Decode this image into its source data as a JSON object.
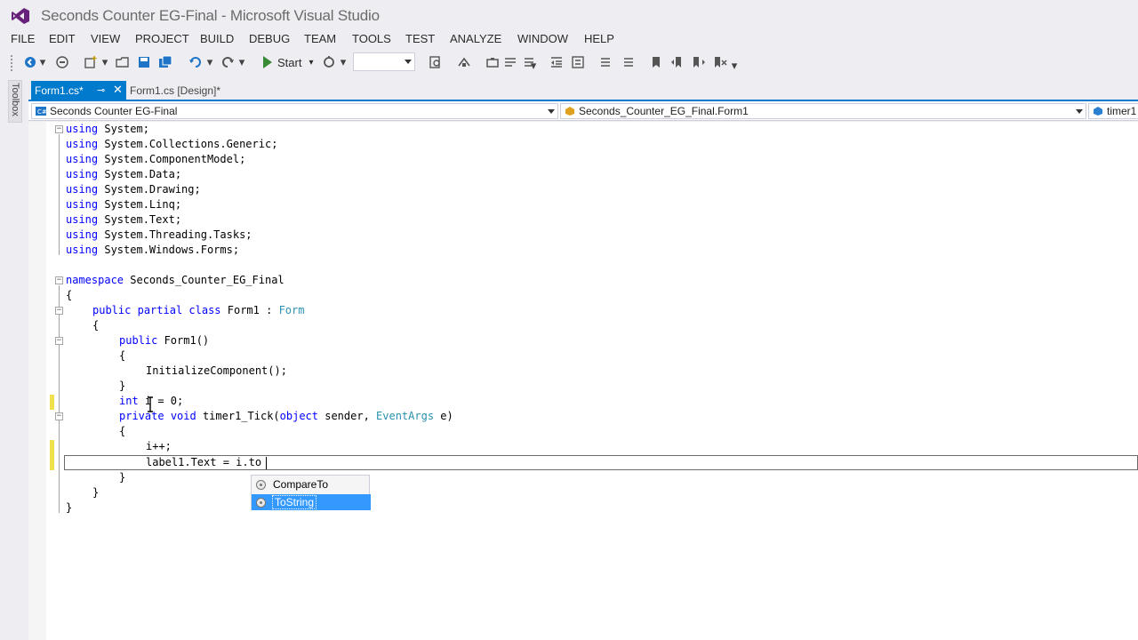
{
  "window": {
    "title": "Seconds Counter EG-Final - Microsoft Visual Studio"
  },
  "menu": [
    "FILE",
    "EDIT",
    "VIEW",
    "PROJECT",
    "BUILD",
    "DEBUG",
    "TEAM",
    "TOOLS",
    "TEST",
    "ANALYZE",
    "WINDOW",
    "HELP"
  ],
  "toolbar": {
    "start_label": "Start",
    "config_value": ""
  },
  "toolbox": {
    "label": "Toolbox"
  },
  "tabs": [
    {
      "label": "Form1.cs*",
      "active": true
    },
    {
      "label": "Form1.cs [Design]*",
      "active": false
    }
  ],
  "navbar": {
    "project": "Seconds Counter EG-Final",
    "type": "Seconds_Counter_EG_Final.Form1",
    "member": "timer1"
  },
  "code": {
    "l1": [
      "using",
      " System;"
    ],
    "l2": [
      "using",
      " System.Collections.Generic;"
    ],
    "l3": [
      "using",
      " System.ComponentModel;"
    ],
    "l4": [
      "using",
      " System.Data;"
    ],
    "l5": [
      "using",
      " System.Drawing;"
    ],
    "l6": [
      "using",
      " System.Linq;"
    ],
    "l7": [
      "using",
      " System.Text;"
    ],
    "l8": [
      "using",
      " System.Threading.Tasks;"
    ],
    "l9": [
      "using",
      " System.Windows.Forms;"
    ],
    "l10": [
      "namespace",
      " Seconds_Counter_EG_Final"
    ],
    "l11": "{",
    "l12": [
      "public",
      " ",
      "partial",
      " ",
      "class",
      " Form1 : ",
      "Form"
    ],
    "l13": "{",
    "l14": [
      "public",
      " Form1()"
    ],
    "l15": "{",
    "l16": "InitializeComponent();",
    "l17": "}",
    "l18": [
      "int",
      " i = 0;"
    ],
    "l19": [
      "private",
      " ",
      "void",
      " timer1_Tick(",
      "object",
      " sender, ",
      "EventArgs",
      " e)"
    ],
    "l20": "{",
    "l21": "i++;",
    "l22": "label1.Text = i.to",
    "l23": "}",
    "l24": "}",
    "l25": "}"
  },
  "intellisense": {
    "items": [
      "CompareTo",
      "ToString"
    ],
    "selected": "ToString"
  },
  "colors": {
    "accent": "#007acc",
    "keyword": "#0000ff",
    "type": "#2b91af",
    "selection": "#3399ff",
    "change_marker": "#f0e04b"
  }
}
